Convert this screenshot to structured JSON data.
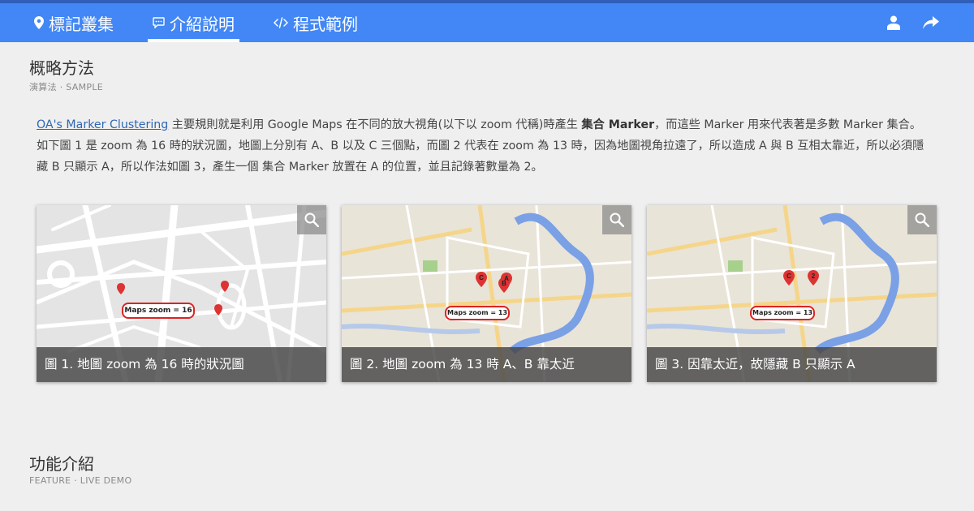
{
  "nav": {
    "tabs": [
      {
        "label": "標記叢集",
        "icon": "map-pin-icon"
      },
      {
        "label": "介紹說明",
        "icon": "chat-bubble-icon",
        "active": true
      },
      {
        "label": "程式範例",
        "icon": "code-icon"
      }
    ],
    "right_icons": [
      "user-icon",
      "share-icon"
    ],
    "colors": {
      "bar": "#4287f5",
      "stripe": "#2f5fb8"
    }
  },
  "sections": [
    {
      "title": "概略方法",
      "subtitle": "演算法 · SAMPLE"
    },
    {
      "title": "功能介紹",
      "subtitle": "FEATURE · LIVE DEMO"
    }
  ],
  "intro": {
    "link_text": "OA's Marker Clustering",
    "text_1": " 主要規則就是利用 Google Maps 在不同的放大視角(以下以 zoom 代稱)時產生 ",
    "bold_text": "集合 Marker",
    "text_2": "，而這些 Marker 用來代表著是多數 Marker 集合。如下圖 1 是 zoom 為 16 時的狀況圖，地圖上分別有 A、B 以及 C 三個點，而圖 2 代表在 zoom 為 13 時，因為地圖視角拉遠了，所以造成 A 與 B 互相太靠近，所以必須隱藏 B 只顯示 A，所以作法如圖 3，產生一個 集合 Marker 放置在 A 的位置，並且記錄著數量為 2。"
  },
  "figures": [
    {
      "caption": "圖 1. 地圖 zoom 為 16 時的狀況圖",
      "map_label": "Maps zoom = 16",
      "zoom_icon": "magnifier-icon"
    },
    {
      "caption": "圖 2. 地圖 zoom 為 13 時 A、B 靠太近",
      "map_label": "Maps zoom = 13",
      "zoom_icon": "magnifier-icon",
      "markers": [
        "C",
        "A",
        "B"
      ]
    },
    {
      "caption": "圖 3. 因靠太近，故隱藏 B 只顯示 A",
      "map_label": "Maps zoom = 13",
      "zoom_icon": "magnifier-icon",
      "markers": [
        "C",
        "2"
      ]
    }
  ]
}
